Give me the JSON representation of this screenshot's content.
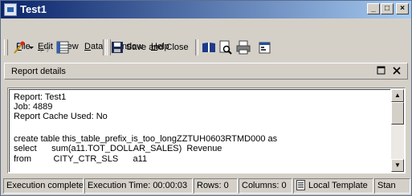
{
  "window": {
    "title": "Test1"
  },
  "menu": {
    "items": [
      "File",
      "Edit",
      "View",
      "Data",
      "Window",
      "Help"
    ]
  },
  "toolbar": {
    "save_close_label": "Save and Close"
  },
  "panel": {
    "title": "Report details"
  },
  "report": {
    "lines": [
      "Report: Test1",
      "Job: 4889",
      "Report Cache Used: No",
      "",
      "create table this_table_prefix_is_too_longZZTUH0603RTMD000 as",
      "select      sum(a11.TOT_DOLLAR_SALES)  Revenue",
      "from         CITY_CTR_SLS      a11"
    ]
  },
  "status": {
    "execution": "Execution complete",
    "execution_time": "Execution Time: 00:00:03",
    "rows": "Rows: 0",
    "columns": "Columns: 0",
    "template": "Local Template",
    "truncated": "Stan"
  },
  "icons": {
    "app": "window-app-icon",
    "minimize": "minimize-icon",
    "maximize": "maximize-icon",
    "close": "close-icon",
    "toolbar": [
      "magic-wand-icon",
      "dropdown-arrow-icon",
      "sql-icon",
      "grid-view-icon",
      "save-icon",
      "book-icon",
      "print-preview-icon",
      "print-icon",
      "properties-icon"
    ]
  }
}
